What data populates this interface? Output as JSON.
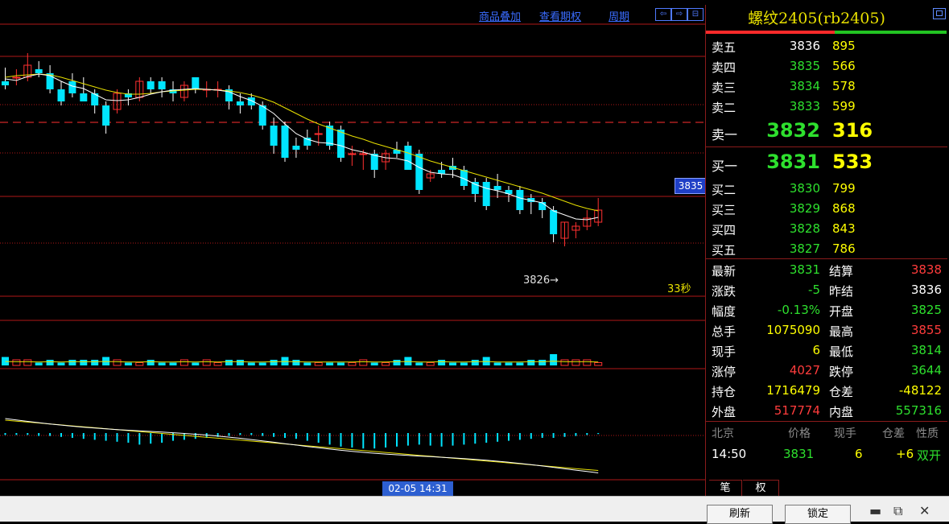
{
  "toolbar": {
    "links": [
      "商品叠加",
      "查看期权",
      "周期"
    ],
    "nav_glyphs": [
      "⇦",
      "⇨",
      "⊟"
    ]
  },
  "chart": {
    "price_tag": "3835",
    "low_label": "3826→",
    "countdown": "33秒",
    "date_badge": "02-05 14:31"
  },
  "chart_data": {
    "type": "candlestick",
    "title": "",
    "candles": [
      {
        "o": 3851.5,
        "h": 3853.2,
        "l": 3850.5,
        "c": 3851.0
      },
      {
        "o": 3852.0,
        "h": 3853.0,
        "l": 3851.0,
        "c": 3852.0
      },
      {
        "o": 3852.0,
        "h": 3855.0,
        "l": 3851.5,
        "c": 3853.5
      },
      {
        "o": 3853.0,
        "h": 3854.0,
        "l": 3852.0,
        "c": 3852.5
      },
      {
        "o": 3852.5,
        "h": 3853.5,
        "l": 3850.0,
        "c": 3850.5
      },
      {
        "o": 3850.5,
        "h": 3851.5,
        "l": 3848.5,
        "c": 3849.0
      },
      {
        "o": 3851.5,
        "h": 3852.5,
        "l": 3849.5,
        "c": 3850.0
      },
      {
        "o": 3850.0,
        "h": 3852.0,
        "l": 3849.0,
        "c": 3849.0
      },
      {
        "o": 3850.0,
        "h": 3850.5,
        "l": 3847.5,
        "c": 3848.5
      },
      {
        "o": 3848.5,
        "h": 3849.0,
        "l": 3845.0,
        "c": 3846.0
      },
      {
        "o": 3848.0,
        "h": 3850.5,
        "l": 3847.5,
        "c": 3850.0
      },
      {
        "o": 3850.0,
        "h": 3850.5,
        "l": 3848.5,
        "c": 3849.5
      },
      {
        "o": 3849.5,
        "h": 3852.0,
        "l": 3849.0,
        "c": 3851.5
      },
      {
        "o": 3851.5,
        "h": 3852.0,
        "l": 3850.0,
        "c": 3850.5
      },
      {
        "o": 3851.5,
        "h": 3852.0,
        "l": 3849.5,
        "c": 3850.5
      },
      {
        "o": 3850.5,
        "h": 3851.5,
        "l": 3849.0,
        "c": 3850.0
      },
      {
        "o": 3849.5,
        "h": 3851.5,
        "l": 3849.0,
        "c": 3851.0
      },
      {
        "o": 3852.0,
        "h": 3852.0,
        "l": 3850.0,
        "c": 3850.5
      },
      {
        "o": 3850.5,
        "h": 3851.5,
        "l": 3849.5,
        "c": 3850.5
      },
      {
        "o": 3850.5,
        "h": 3851.5,
        "l": 3849.5,
        "c": 3850.5
      },
      {
        "o": 3850.5,
        "h": 3851.0,
        "l": 3848.0,
        "c": 3849.0
      },
      {
        "o": 3849.0,
        "h": 3850.0,
        "l": 3847.5,
        "c": 3848.5
      },
      {
        "o": 3849.5,
        "h": 3850.0,
        "l": 3848.0,
        "c": 3848.5
      },
      {
        "o": 3848.5,
        "h": 3849.0,
        "l": 3845.5,
        "c": 3846.0
      },
      {
        "o": 3846.0,
        "h": 3847.0,
        "l": 3842.5,
        "c": 3843.5
      },
      {
        "o": 3846.0,
        "h": 3846.5,
        "l": 3841.5,
        "c": 3842.0
      },
      {
        "o": 3843.5,
        "h": 3844.5,
        "l": 3842.0,
        "c": 3843.0
      },
      {
        "o": 3844.5,
        "h": 3845.5,
        "l": 3843.0,
        "c": 3843.5
      },
      {
        "o": 3845.0,
        "h": 3846.0,
        "l": 3843.5,
        "c": 3845.0
      },
      {
        "o": 3846.0,
        "h": 3846.5,
        "l": 3843.0,
        "c": 3843.5
      },
      {
        "o": 3845.5,
        "h": 3846.0,
        "l": 3841.5,
        "c": 3842.0
      },
      {
        "o": 3842.5,
        "h": 3843.5,
        "l": 3841.0,
        "c": 3842.5
      },
      {
        "o": 3842.5,
        "h": 3843.0,
        "l": 3840.5,
        "c": 3842.5
      },
      {
        "o": 3842.5,
        "h": 3843.0,
        "l": 3839.5,
        "c": 3840.5
      },
      {
        "o": 3841.5,
        "h": 3843.0,
        "l": 3840.5,
        "c": 3842.5
      },
      {
        "o": 3843.0,
        "h": 3844.0,
        "l": 3842.0,
        "c": 3842.5
      },
      {
        "o": 3843.5,
        "h": 3844.0,
        "l": 3840.5,
        "c": 3840.5
      },
      {
        "o": 3842.5,
        "h": 3843.0,
        "l": 3837.5,
        "c": 3838.0
      },
      {
        "o": 3839.5,
        "h": 3840.5,
        "l": 3839.0,
        "c": 3840.0
      },
      {
        "o": 3840.5,
        "h": 3841.5,
        "l": 3839.5,
        "c": 3840.0
      },
      {
        "o": 3841.0,
        "h": 3842.0,
        "l": 3839.5,
        "c": 3840.5
      },
      {
        "o": 3840.5,
        "h": 3841.0,
        "l": 3838.0,
        "c": 3838.5
      },
      {
        "o": 3839.0,
        "h": 3839.5,
        "l": 3836.5,
        "c": 3837.5
      },
      {
        "o": 3839.0,
        "h": 3839.5,
        "l": 3835.5,
        "c": 3836.0
      },
      {
        "o": 3838.5,
        "h": 3840.0,
        "l": 3837.0,
        "c": 3838.0
      },
      {
        "o": 3838.0,
        "h": 3838.5,
        "l": 3836.5,
        "c": 3837.5
      },
      {
        "o": 3838.0,
        "h": 3838.5,
        "l": 3835.0,
        "c": 3835.5
      },
      {
        "o": 3837.0,
        "h": 3837.5,
        "l": 3835.0,
        "c": 3836.5
      },
      {
        "o": 3836.5,
        "h": 3837.0,
        "l": 3834.5,
        "c": 3835.5
      },
      {
        "o": 3835.5,
        "h": 3836.0,
        "l": 3831.5,
        "c": 3832.5
      },
      {
        "o": 3832.0,
        "h": 3834.0,
        "l": 3831.0,
        "c": 3834.0
      },
      {
        "o": 3833.0,
        "h": 3834.0,
        "l": 3832.0,
        "c": 3833.5
      },
      {
        "o": 3833.5,
        "h": 3835.5,
        "l": 3833.0,
        "c": 3834.5
      },
      {
        "o": 3834.0,
        "h": 3837.0,
        "l": 3833.5,
        "c": 3835.5
      }
    ],
    "ma_fast": [
      3851.8,
      3851.6,
      3852.1,
      3852.4,
      3852.2,
      3851.5,
      3850.9,
      3850.6,
      3849.9,
      3849.2,
      3849.1,
      3849.2,
      3849.5,
      3849.9,
      3850.2,
      3850.4,
      3850.5,
      3850.6,
      3850.5,
      3850.4,
      3850.2,
      3849.6,
      3849.1,
      3848.4,
      3847.5,
      3846.2,
      3845.0,
      3844.3,
      3843.9,
      3843.8,
      3843.5,
      3843.0,
      3842.7,
      3842.3,
      3842.0,
      3841.9,
      3841.6,
      3840.8,
      3840.2,
      3840.0,
      3839.9,
      3839.4,
      3838.7,
      3838.2,
      3837.9,
      3837.5,
      3837.0,
      3836.7,
      3836.4,
      3835.4,
      3834.9,
      3834.4,
      3834.3,
      3834.6
    ],
    "ma_slow": [
      3852.0,
      3852.2,
      3852.3,
      3852.4,
      3852.3,
      3852.0,
      3851.6,
      3851.2,
      3850.8,
      3850.4,
      3850.1,
      3849.9,
      3849.9,
      3850.0,
      3850.2,
      3850.3,
      3850.4,
      3850.5,
      3850.5,
      3850.4,
      3850.3,
      3850.1,
      3849.8,
      3849.4,
      3848.9,
      3848.2,
      3847.5,
      3846.8,
      3846.2,
      3845.7,
      3845.2,
      3844.7,
      3844.3,
      3843.8,
      3843.4,
      3843.0,
      3842.6,
      3842.1,
      3841.6,
      3841.2,
      3840.8,
      3840.4,
      3840.0,
      3839.6,
      3839.2,
      3838.8,
      3838.4,
      3838.0,
      3837.6,
      3837.1,
      3836.6,
      3836.1,
      3835.7,
      3835.4
    ],
    "ylim": [
      3826,
      3857
    ],
    "grid": true,
    "volume": [
      3,
      2,
      2,
      1,
      2,
      1,
      2,
      2,
      2,
      3,
      2,
      1,
      1,
      2,
      1,
      1,
      2,
      1,
      2,
      1,
      2,
      2,
      1,
      1,
      2,
      3,
      2,
      1,
      1,
      1,
      1,
      1,
      2,
      1,
      1,
      2,
      3,
      1,
      1,
      2,
      1,
      1,
      2,
      3,
      1,
      1,
      1,
      2,
      2,
      4,
      2,
      2,
      2,
      1
    ],
    "macd_hist": [
      2,
      2,
      2,
      3,
      3,
      4,
      5,
      6,
      7,
      8,
      9,
      10,
      12,
      11,
      10,
      8,
      7,
      6,
      5,
      4,
      3,
      2,
      2,
      3,
      4,
      5,
      6,
      8,
      10,
      12,
      14,
      15,
      16,
      16,
      15,
      14,
      13,
      12,
      13,
      14,
      13,
      12,
      11,
      10,
      9,
      8,
      7,
      6,
      5,
      5,
      4,
      3,
      2,
      1
    ]
  },
  "quote": {
    "title": "螺纹2405(rb2405)",
    "asks": [
      {
        "label": "卖五",
        "price": "3836",
        "vol": "895"
      },
      {
        "label": "卖四",
        "price": "3835",
        "vol": "566"
      },
      {
        "label": "卖三",
        "price": "3834",
        "vol": "578"
      },
      {
        "label": "卖二",
        "price": "3833",
        "vol": "599"
      },
      {
        "label": "卖一",
        "price": "3832",
        "vol": "316"
      }
    ],
    "bids": [
      {
        "label": "买一",
        "price": "3831",
        "vol": "533"
      },
      {
        "label": "买二",
        "price": "3830",
        "vol": "799"
      },
      {
        "label": "买三",
        "price": "3829",
        "vol": "868"
      },
      {
        "label": "买四",
        "price": "3828",
        "vol": "843"
      },
      {
        "label": "买五",
        "price": "3827",
        "vol": "786"
      }
    ],
    "stats": [
      {
        "l1": "最新",
        "v1": "3831",
        "l2": "结算",
        "v2": "3838"
      },
      {
        "l1": "涨跌",
        "v1": "-5",
        "l2": "昨结",
        "v2": "3836"
      },
      {
        "l1": "幅度",
        "v1": "-0.13%",
        "l2": "开盘",
        "v2": "3825"
      },
      {
        "l1": "总手",
        "v1": "1075090",
        "l2": "最高",
        "v2": "3855"
      },
      {
        "l1": "现手",
        "v1": "6",
        "l2": "最低",
        "v2": "3814"
      },
      {
        "l1": "涨停",
        "v1": "4027",
        "l2": "跌停",
        "v2": "3644"
      },
      {
        "l1": "持仓",
        "v1": "1716479",
        "l2": "仓差",
        "v2": "-48122"
      },
      {
        "l1": "外盘",
        "v1": "517774",
        "l2": "内盘",
        "v2": "557316"
      }
    ],
    "tick_headers": [
      "北京",
      "价格",
      "现手",
      "仓差",
      "性质"
    ],
    "tick": {
      "time": "14:50",
      "price": "3831",
      "vol": "6",
      "oi": "+6",
      "type": "双开"
    },
    "tabs": [
      "笔",
      "权"
    ]
  },
  "footer": {
    "refresh": "刷新",
    "lock": "锁定",
    "minimize": "▬",
    "restore": "⧉",
    "close": "✕"
  },
  "colors": {
    "up": "#ff3030",
    "down": "#00e5ff",
    "ma_fast": "#ffffff",
    "ma_slow": "#e8e000",
    "grid": "#b01818"
  }
}
